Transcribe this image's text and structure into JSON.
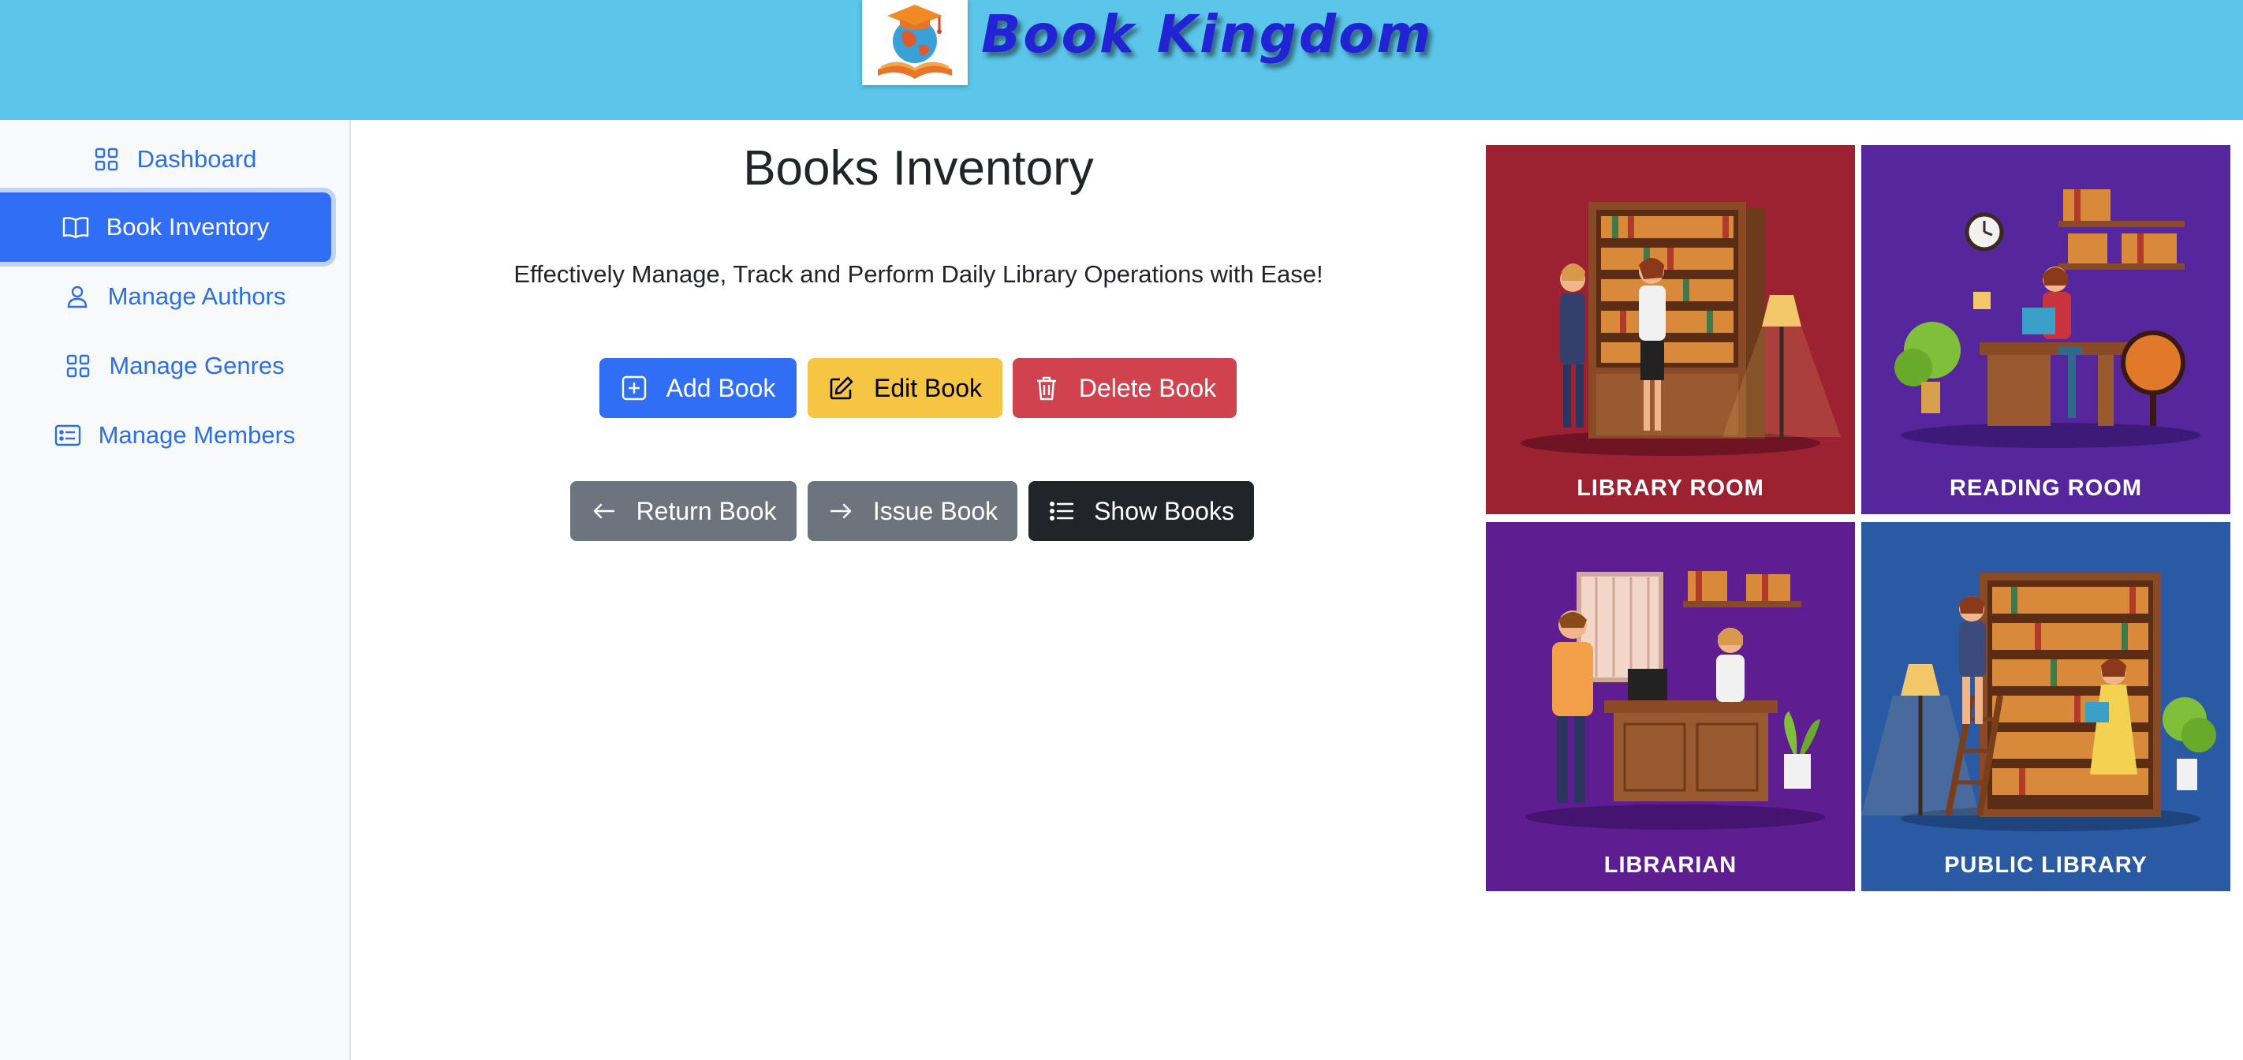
{
  "header": {
    "brand": "Book Kingdom",
    "logo_icon": "graduation-cap-globe-book-logo",
    "background_color": "#5bc6ea",
    "brand_color": "#2323d6"
  },
  "sidebar": {
    "items": [
      {
        "label": "Dashboard",
        "icon": "grid-icon",
        "active": false
      },
      {
        "label": "Book Inventory",
        "icon": "open-book-icon",
        "active": true
      },
      {
        "label": "Manage Authors",
        "icon": "person-icon",
        "active": false
      },
      {
        "label": "Manage Genres",
        "icon": "grid-icon",
        "active": false
      },
      {
        "label": "Manage Members",
        "icon": "card-list-icon",
        "active": false
      }
    ],
    "link_color": "#2b6fe0",
    "active_color": "#2f6ef5"
  },
  "main": {
    "title": "Books Inventory",
    "subtitle": "Effectively Manage, Track and Perform Daily Library Operations with Ease!",
    "actions_row1": [
      {
        "label": "Add Book",
        "icon": "plus-square-icon",
        "color": "#2f6ef5"
      },
      {
        "label": "Edit Book",
        "icon": "pencil-square-icon",
        "color": "#f7c544"
      },
      {
        "label": "Delete Book",
        "icon": "trash-icon",
        "color": "#d0424e"
      }
    ],
    "actions_row2": [
      {
        "label": "Return Book",
        "icon": "arrow-left-icon",
        "color": "#6c757d"
      },
      {
        "label": "Issue Book",
        "icon": "arrow-right-icon",
        "color": "#6c757d"
      },
      {
        "label": "Show Books",
        "icon": "list-icon",
        "color": "#212529"
      }
    ]
  },
  "tiles": [
    {
      "label": "LIBRARY ROOM",
      "background": "#9c2231"
    },
    {
      "label": "READING ROOM",
      "background": "#55269c"
    },
    {
      "label": "LIBRARIAN",
      "background": "#5e1d91"
    },
    {
      "label": "PUBLIC LIBRARY",
      "background": "#2b5aa5"
    }
  ]
}
